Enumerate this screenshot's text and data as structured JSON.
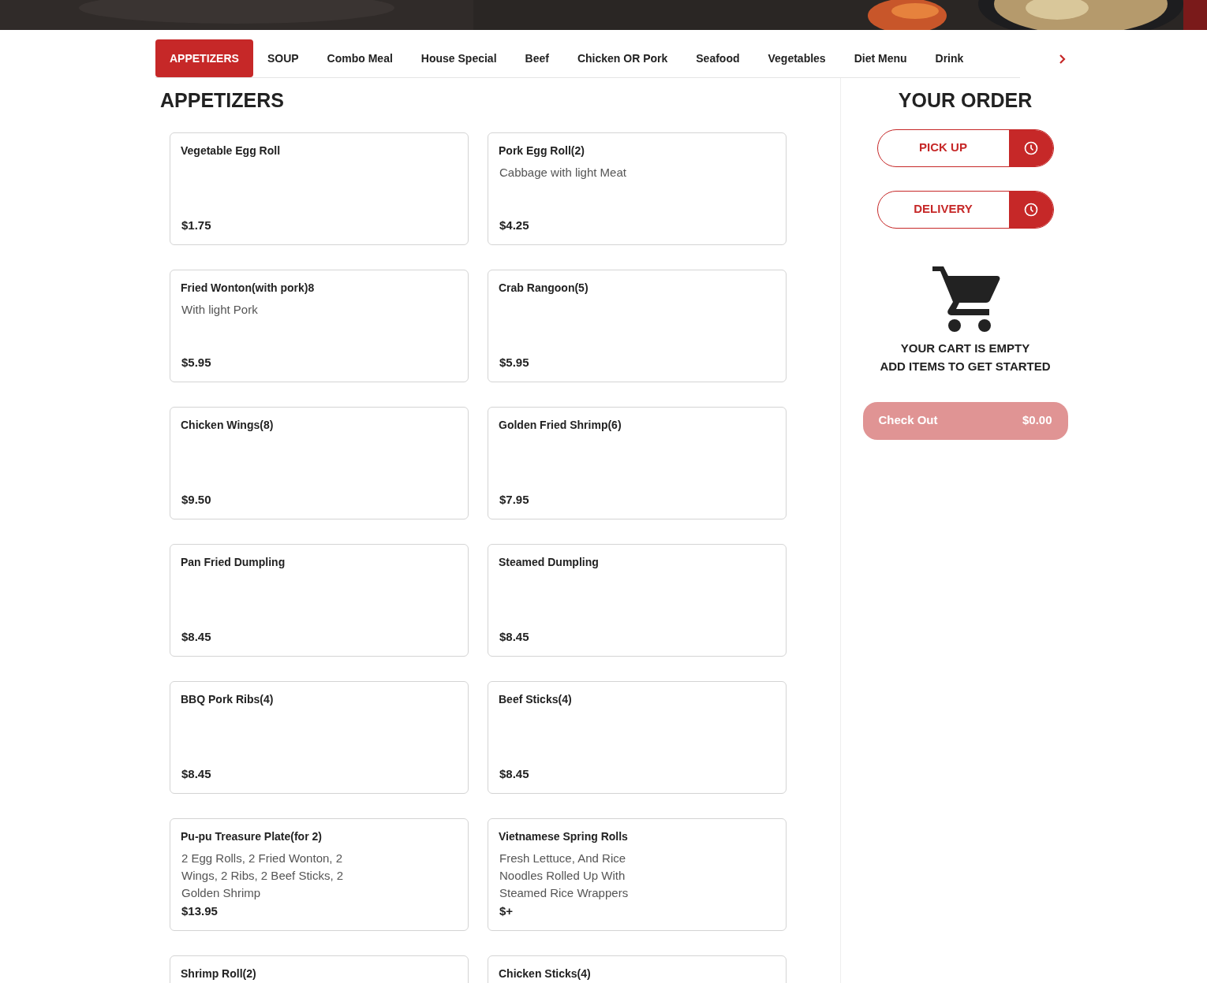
{
  "tabs": [
    {
      "label": "APPETIZERS",
      "selected": true
    },
    {
      "label": "SOUP",
      "selected": false
    },
    {
      "label": "Combo Meal",
      "selected": false
    },
    {
      "label": "House Special",
      "selected": false
    },
    {
      "label": "Beef",
      "selected": false
    },
    {
      "label": "Chicken OR Pork",
      "selected": false
    },
    {
      "label": "Seafood",
      "selected": false
    },
    {
      "label": "Vegetables",
      "selected": false
    },
    {
      "label": "Diet Menu",
      "selected": false
    },
    {
      "label": "Drink",
      "selected": false
    }
  ],
  "section_title": "APPETIZERS",
  "items": [
    {
      "name": "Vegetable Egg Roll",
      "price": "$1.75"
    },
    {
      "name": "Pork Egg Roll(2)",
      "description": "Cabbage with light Meat",
      "price": "$4.25"
    },
    {
      "name": "Fried Wonton(with pork)8",
      "description": "With light Pork",
      "price": "$5.95"
    },
    {
      "name": "Crab Rangoon(5)",
      "price": "$5.95"
    },
    {
      "name": "Chicken Wings(8)",
      "price": "$9.50"
    },
    {
      "name": "Golden Fried Shrimp(6)",
      "price": "$7.95"
    },
    {
      "name": "Pan Fried Dumpling",
      "price": "$8.45"
    },
    {
      "name": "Steamed Dumpling",
      "price": "$8.45"
    },
    {
      "name": "BBQ Pork Ribs(4)",
      "price": "$8.45"
    },
    {
      "name": "Beef Sticks(4)",
      "price": "$8.45"
    },
    {
      "name": "Pu-pu Treasure Plate(for 2)",
      "description": "2 Egg Rolls, 2 Fried Wonton, 2 Wings, 2 Ribs, 2 Beef Sticks, 2 Golden Shrimp",
      "price": "$13.95"
    },
    {
      "name": "Vietnamese Spring Rolls",
      "description": "Fresh Lettuce, And Rice Noodles Rolled Up With Steamed Rice Wrappers",
      "price": "$+"
    },
    {
      "name": "Shrimp Roll(2)"
    },
    {
      "name": "Chicken Sticks(4)"
    }
  ],
  "order": {
    "title": "YOUR ORDER",
    "options": [
      "PICK UP",
      "DELIVERY"
    ],
    "empty_lines": [
      "YOUR CART IS EMPTY",
      "ADD ITEMS TO GET STARTED"
    ],
    "checkout": {
      "label": "Check Out",
      "total": "$0.00",
      "disabled": true
    }
  }
}
